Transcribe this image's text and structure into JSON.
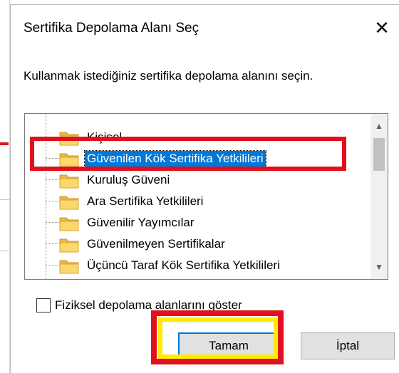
{
  "dialog": {
    "title": "Sertifika Depolama Alanı Seç",
    "close_glyph": "✕",
    "instruction": "Kullanmak istediğiniz sertifika depolama alanını seçin."
  },
  "tree": {
    "items": [
      {
        "label": "Kişisel",
        "selected": false
      },
      {
        "label": "Güvenilen Kök Sertifika Yetkilileri",
        "selected": true
      },
      {
        "label": "Kuruluş Güveni",
        "selected": false
      },
      {
        "label": "Ara Sertifika Yetkilileri",
        "selected": false
      },
      {
        "label": "Güvenilir Yayımcılar",
        "selected": false
      },
      {
        "label": "Güvenilmeyen Sertifikalar",
        "selected": false
      },
      {
        "label": "Üçüncü Taraf Kök Sertifika Yetkilileri",
        "selected": false
      }
    ],
    "scroll_up_glyph": "▲",
    "scroll_down_glyph": "▼"
  },
  "options": {
    "show_physical_label": "Fiziksel depolama alanlarını göster",
    "show_physical_checked": false
  },
  "buttons": {
    "ok_label": "Tamam",
    "cancel_label": "İptal"
  },
  "colors": {
    "selection": "#0078d7",
    "annotation_red": "#e0101e",
    "annotation_yellow": "#ffec00"
  }
}
